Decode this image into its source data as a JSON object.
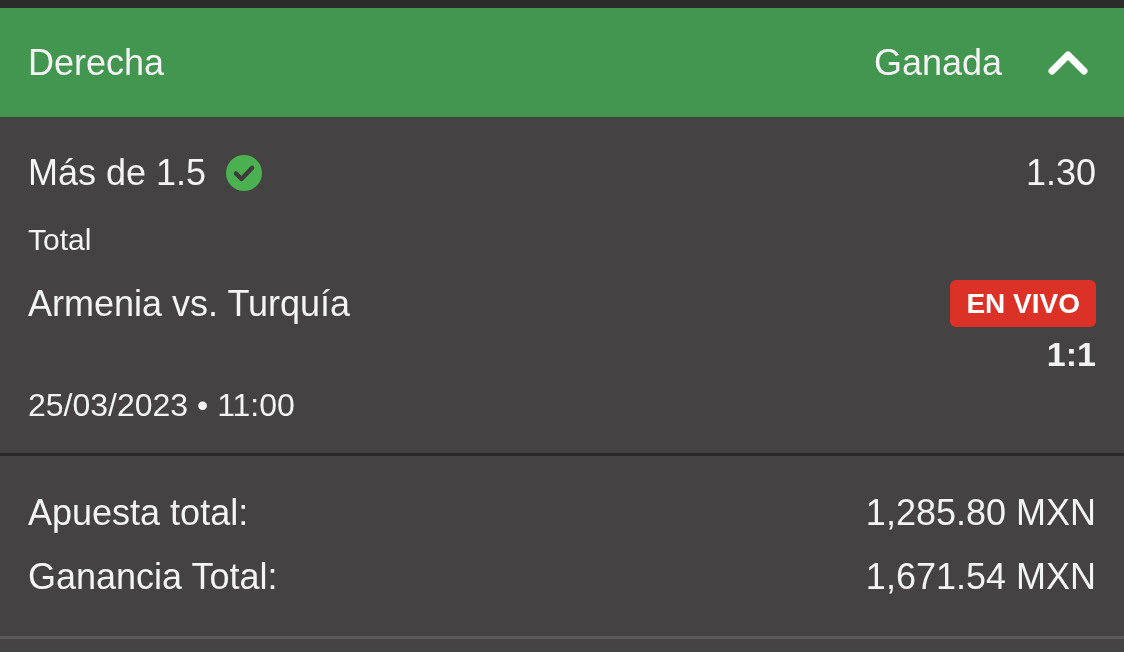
{
  "header": {
    "title": "Derecha",
    "status": "Ganada",
    "expanded": true
  },
  "selection": {
    "pick": "Más de 1.5",
    "won": true,
    "odds": "1.30",
    "market": "Total",
    "event": "Armenia vs. Turquía",
    "live_badge": "EN VIVO",
    "score": "1:1",
    "datetime": "25/03/2023 • 11:00"
  },
  "summary": [
    {
      "label": "Apuesta total:",
      "value": "1,285.80 MXN"
    },
    {
      "label": "Ganancia Total:",
      "value": "1,671.54 MXN"
    }
  ]
}
